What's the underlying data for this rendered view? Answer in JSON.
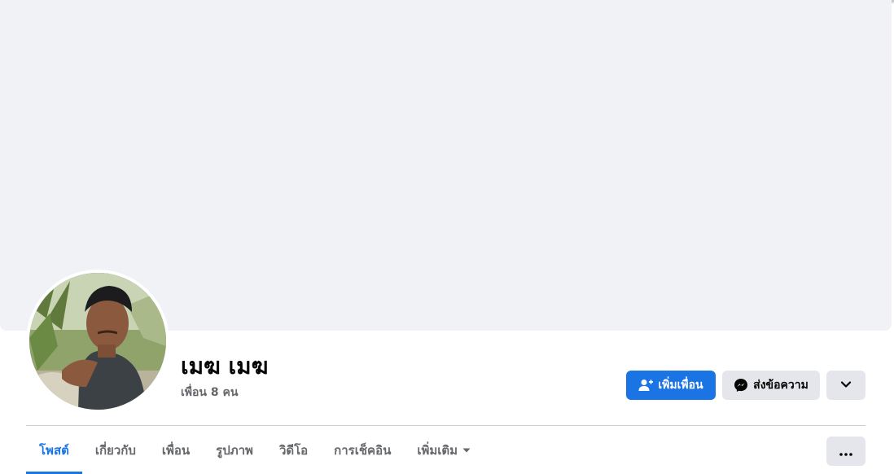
{
  "profile": {
    "name": "เมฆ เมฆ",
    "friends_text": "เพื่อน 8 คน"
  },
  "actions": {
    "add_friend_label": "เพิ่มเพื่อน",
    "message_label": "ส่งข้อความ"
  },
  "tabs": [
    {
      "label": "โพสต์",
      "active": true
    },
    {
      "label": "เกี่ยวกับ",
      "active": false
    },
    {
      "label": "เพื่อน",
      "active": false
    },
    {
      "label": "รูปภาพ",
      "active": false
    },
    {
      "label": "วิดีโอ",
      "active": false
    },
    {
      "label": "การเช็คอิน",
      "active": false
    },
    {
      "label": "เพิ่มเติม",
      "active": false
    }
  ],
  "icons": {
    "add_friend": "person-plus-icon",
    "message": "messenger-icon",
    "more_options": "chevron-down-icon",
    "tab_more": "caret-down-icon",
    "overflow": "ellipsis-icon"
  },
  "colors": {
    "accent": "#1b74e4",
    "cover": "#f0f2f5",
    "secondary_button": "#e4e6eb",
    "muted_text": "#65676b"
  }
}
